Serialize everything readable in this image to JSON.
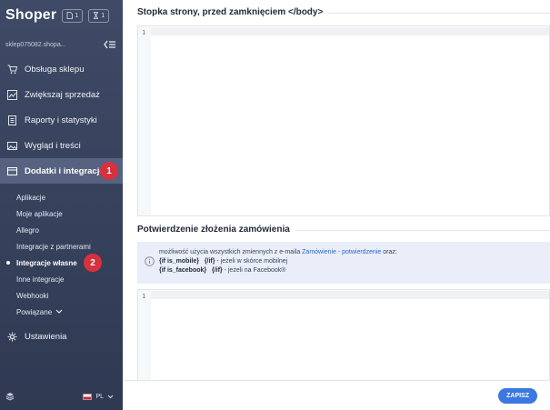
{
  "app": {
    "logo": "Shoper"
  },
  "header_badges": [
    {
      "icon": "document-icon",
      "count": "1"
    },
    {
      "icon": "hourglass-icon",
      "count": "1"
    }
  ],
  "store": {
    "name": "sklep075082.shopa..."
  },
  "nav": [
    {
      "label": "Obsługa sklepu",
      "icon": "cart-icon"
    },
    {
      "label": "Zwiększaj sprzedaż",
      "icon": "chart-icon"
    },
    {
      "label": "Raporty i statystyki",
      "icon": "report-icon"
    },
    {
      "label": "Wygląd i treści",
      "icon": "image-icon"
    },
    {
      "label": "Dodatki i integracje",
      "icon": "addons-icon"
    }
  ],
  "subnav": [
    {
      "label": "Aplikacje"
    },
    {
      "label": "Moje aplikacje"
    },
    {
      "label": "Allegro"
    },
    {
      "label": "Integracje z partnerami"
    },
    {
      "label": "Integracje własne"
    },
    {
      "label": "Inne integracje"
    },
    {
      "label": "Webhooki"
    },
    {
      "label": "Powiązane"
    }
  ],
  "settings": {
    "label": "Ustawienia",
    "icon": "gear-icon"
  },
  "annotations": {
    "step1": "1",
    "step2": "2"
  },
  "footer": {
    "lang": "PL"
  },
  "sections": {
    "footer_code": {
      "title": "Stopka strony, przed zamknięciem </body>",
      "line": "1"
    },
    "order_confirm": {
      "title": "Potwierdzenie złożenia zamówienia",
      "line": "1"
    }
  },
  "info": {
    "intro": "możliwość użycia wszystkich zmiennych z e-maila ",
    "link": "Zamówienie - potwierdzenie",
    "intro_end": " oraz:",
    "mobile_code": "{if is_mobile}",
    "mobile_close": "{/if}",
    "mobile_desc": " - jeżeli w skórce mobilnej",
    "fb_code": "{if is_facebook}",
    "fb_close": "{/if}",
    "fb_desc": " - jeżeli na Facebook®"
  },
  "actions": {
    "save": "ZAPISZ"
  },
  "colors": {
    "sidebar": "#3e4a66",
    "accent": "#3b78e0",
    "badge": "#d9303e"
  }
}
